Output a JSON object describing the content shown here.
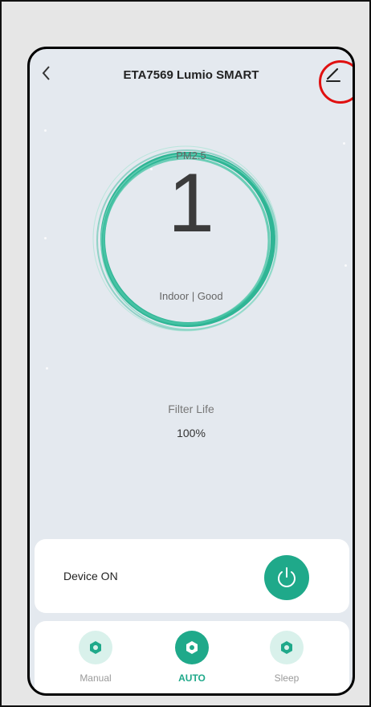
{
  "device": {
    "title": "ETA7569 Lumio SMART"
  },
  "air": {
    "label": "PM2.5",
    "value": "1",
    "status": "Indoor | Good"
  },
  "filter": {
    "label": "Filter Life",
    "value": "100%"
  },
  "power": {
    "label": "Device ON"
  },
  "modes": [
    {
      "label": "Manual",
      "active": false
    },
    {
      "label": "AUTO",
      "active": true
    },
    {
      "label": "Sleep",
      "active": false
    }
  ],
  "colors": {
    "accent": "#1fa98a",
    "accent_light": "#d9f1eb",
    "background": "#e4e9ef",
    "highlight": "#e01010"
  },
  "icons": {
    "back": "chevron-left-icon",
    "edit": "pencil-icon",
    "power": "power-icon",
    "mode": "hexagon-nut-icon"
  }
}
